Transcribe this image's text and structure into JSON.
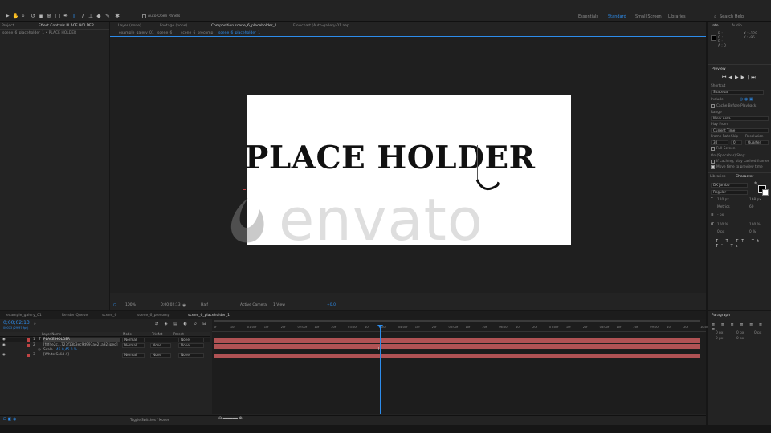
{
  "toolbar": {
    "auto_open": "Auto-Open Panels",
    "workspaces": [
      "Essentials",
      "Standard",
      "Small Screen",
      "Libraries"
    ],
    "active_ws": "Standard",
    "search": "Search Help"
  },
  "project": {
    "tab1": "Project",
    "tab2": "Effect Controls PLACE HOLDER",
    "breadcrumb": "scene_6_placeholder_1 • PLACE HOLDER"
  },
  "viewer": {
    "tabs": [
      "Layer (none)",
      "Footage (none)",
      "Composition scene_6_placeholder_1",
      "Flowchart (Auto-gallery-01.aep"
    ],
    "nav": [
      "example_galery_01",
      "scene_6",
      "scene_6_precomp",
      "scene_6_placeholder_1"
    ],
    "text": "PLACE HOLDER",
    "watermark": "envato",
    "zoom": "100%",
    "timecode": "0;00;02;13",
    "resolution": "Half",
    "camera": "Active Camera",
    "views": "1 View",
    "offset": "+0.0"
  },
  "info": {
    "tab1": "Info",
    "tab2": "Audio",
    "r": "R :",
    "g": "G :",
    "b": "B :",
    "a": "A : 0",
    "x": "X : -129",
    "y": "Y : -95"
  },
  "preview": {
    "title": "Preview",
    "shortcut_lbl": "Shortcut",
    "shortcut": "Spacebar",
    "include": "Include:",
    "cache": "Cache Before Playback",
    "range_lbl": "Range",
    "range": "Work Area",
    "play_from_lbl": "Play From",
    "play_from": "Current Time",
    "frame_rate_lbl": "Frame Rate",
    "skip_lbl": "Skip",
    "resolution_lbl": "Resolution",
    "frame_rate": "30",
    "skip": "0",
    "resolution": "Quarter",
    "fullscreen": "Full Screen",
    "stop_lbl": "On (Spacebar) Stop:",
    "opt1": "If caching, play cached frames",
    "opt2": "Move time to preview time"
  },
  "character": {
    "tab1": "Libraries",
    "tab2": "Character",
    "font": "DK Jambo",
    "style": "Regular",
    "size": "120 px",
    "leading": "168 px",
    "kerning": "Metrics",
    "tracking": "60",
    "stroke": "- px",
    "vscale": "100 %",
    "hscale": "100 %",
    "baseline": "0 px",
    "tsume": "0 %"
  },
  "paragraph": {
    "title": "Paragraph",
    "indent1": "0 px",
    "indent2": "0 px",
    "indent3": "0 px",
    "space1": "0 px",
    "space2": "0 px"
  },
  "timeline": {
    "tabs": [
      "example_galery_01",
      "Render Queue",
      "scene_6",
      "scene_6_precomp",
      "scene_6_placeholder_1"
    ],
    "timecode": "0;00;02;13",
    "timecode_sub": "00073 (29.97 fps)",
    "cols": {
      "layer": "Layer Name",
      "mode": "Mode",
      "trkmat": "TrkMat",
      "parent": "Parent"
    },
    "layers": [
      {
        "num": "1",
        "name": "PLACE HOLDER",
        "mode": "Normal",
        "trk": "",
        "parent": "None"
      },
      {
        "num": "2",
        "name": "[f8f4e2c...727f13b3ec9d997ae21a92.jpeg]",
        "mode": "Normal",
        "trk": "None",
        "parent": "None"
      },
      {
        "num": "",
        "name": "Scale",
        "mode": "",
        "trk": "",
        "parent": "",
        "value": "45.0,45.0 %"
      },
      {
        "num": "3",
        "name": "[White Solid 4]",
        "mode": "Normal",
        "trk": "None",
        "parent": "None"
      }
    ],
    "ruler": [
      "0f",
      "10f",
      "01:00f",
      "10f",
      "20f",
      "02:00f",
      "10f",
      "20f",
      "03:00f",
      "10f",
      "20f",
      "04:00f",
      "10f",
      "20f",
      "05:00f",
      "10f",
      "20f",
      "06:00f",
      "10f",
      "20f",
      "07:00f",
      "10f",
      "20f",
      "08:00f",
      "10f",
      "20f",
      "09:00f",
      "10f",
      "20f",
      "10:00f"
    ],
    "toggle": "Toggle Switches / Modes"
  },
  "colors": {
    "accent": "#2d8ceb",
    "layer_bar": "#b05254",
    "label_red": "#c04444"
  }
}
